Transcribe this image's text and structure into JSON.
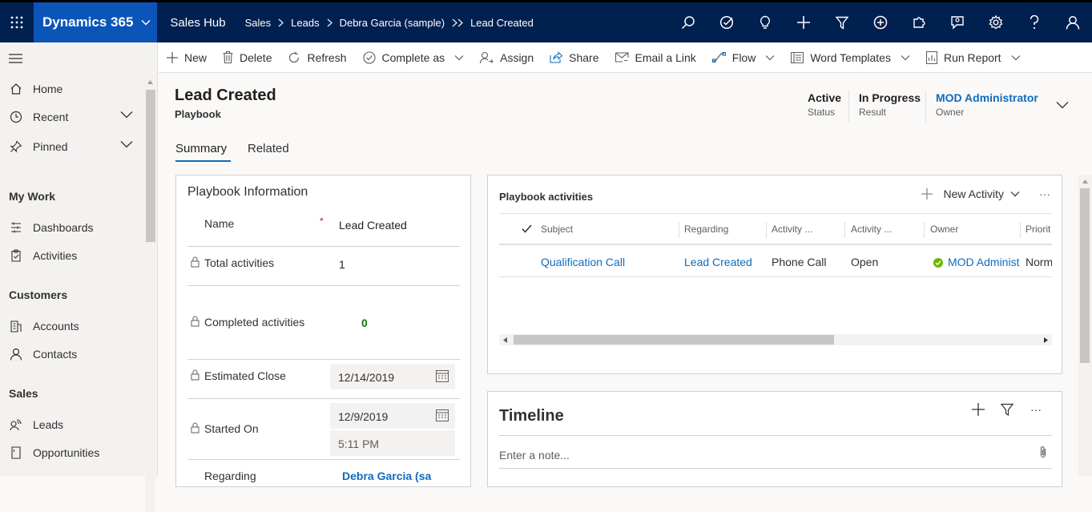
{
  "topbar": {
    "brand": "Dynamics 365",
    "app": "Sales Hub",
    "breadcrumbs": [
      "Sales",
      "Leads",
      "Debra Garcia (sample)",
      "Lead Created"
    ],
    "icons": [
      "search-icon",
      "task-icon",
      "lightbulb-icon",
      "plus-icon",
      "filter-icon",
      "circle-plus-icon",
      "puzzle-icon",
      "chat-icon",
      "settings-icon",
      "help-icon",
      "user-icon"
    ]
  },
  "leftnav": {
    "items": [
      {
        "label": "Home"
      },
      {
        "label": "Recent"
      },
      {
        "label": "Pinned"
      }
    ],
    "groups": [
      {
        "title": "My Work",
        "items": [
          {
            "label": "Dashboards"
          },
          {
            "label": "Activities"
          }
        ]
      },
      {
        "title": "Customers",
        "items": [
          {
            "label": "Accounts"
          },
          {
            "label": "Contacts"
          }
        ]
      },
      {
        "title": "Sales",
        "items": [
          {
            "label": "Leads"
          },
          {
            "label": "Opportunities"
          }
        ]
      }
    ]
  },
  "commands": {
    "new": "New",
    "delete": "Delete",
    "refresh": "Refresh",
    "complete_as": "Complete as",
    "assign": "Assign",
    "share": "Share",
    "email_link": "Email a Link",
    "flow": "Flow",
    "word_templates": "Word Templates",
    "run_report": "Run Report"
  },
  "header": {
    "title": "Lead Created",
    "entity": "Playbook",
    "status_value": "Active",
    "status_label": "Status",
    "result_value": "In Progress",
    "result_label": "Result",
    "owner_value": "MOD Administrator",
    "owner_label": "Owner"
  },
  "tabs": {
    "summary": "Summary",
    "related": "Related"
  },
  "playbook_info": {
    "title": "Playbook Information",
    "name_label": "Name",
    "required_mark": "*",
    "name_value": "Lead Created",
    "total_label": "Total activities",
    "total_value": "1",
    "completed_label": "Completed activities",
    "completed_value": "0",
    "est_close_label": "Estimated Close",
    "est_close_value": "12/14/2019",
    "started_label": "Started On",
    "started_date": "12/9/2019",
    "started_time": "5:11 PM",
    "regarding_label": "Regarding",
    "regarding_value": "Debra Garcia (sa"
  },
  "activities": {
    "title": "Playbook activities",
    "new_activity": "New Activity",
    "more": "···",
    "columns": [
      "Subject",
      "Regarding",
      "Activity ...",
      "Activity ...",
      "Owner",
      "Priorit"
    ],
    "rows": [
      {
        "subject": "Qualification Call",
        "regarding": "Lead Created",
        "type": "Phone Call",
        "status": "Open",
        "owner": "MOD Administ",
        "priority": "Norm"
      }
    ]
  },
  "timeline": {
    "title": "Timeline",
    "more": "···",
    "note_placeholder": "Enter a note..."
  },
  "colors": {
    "topbar": "#002050",
    "brand": "#0b55b9",
    "link": "#0f6cbd",
    "success": "#107c10"
  }
}
